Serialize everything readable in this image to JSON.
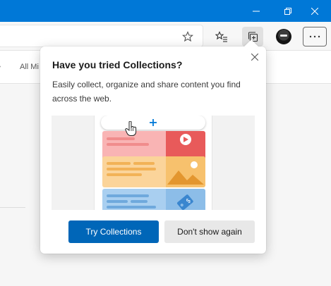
{
  "favorites_bar": {
    "folder_label": "All Mi"
  },
  "popup": {
    "title": "Have you tried Collections?",
    "description": "Easily collect, organize and share content you find across the web.",
    "primary_button": "Try Collections",
    "secondary_button": "Don't show again"
  },
  "colors": {
    "titlebar": "#0078d7",
    "primary_button": "#0066b8"
  }
}
